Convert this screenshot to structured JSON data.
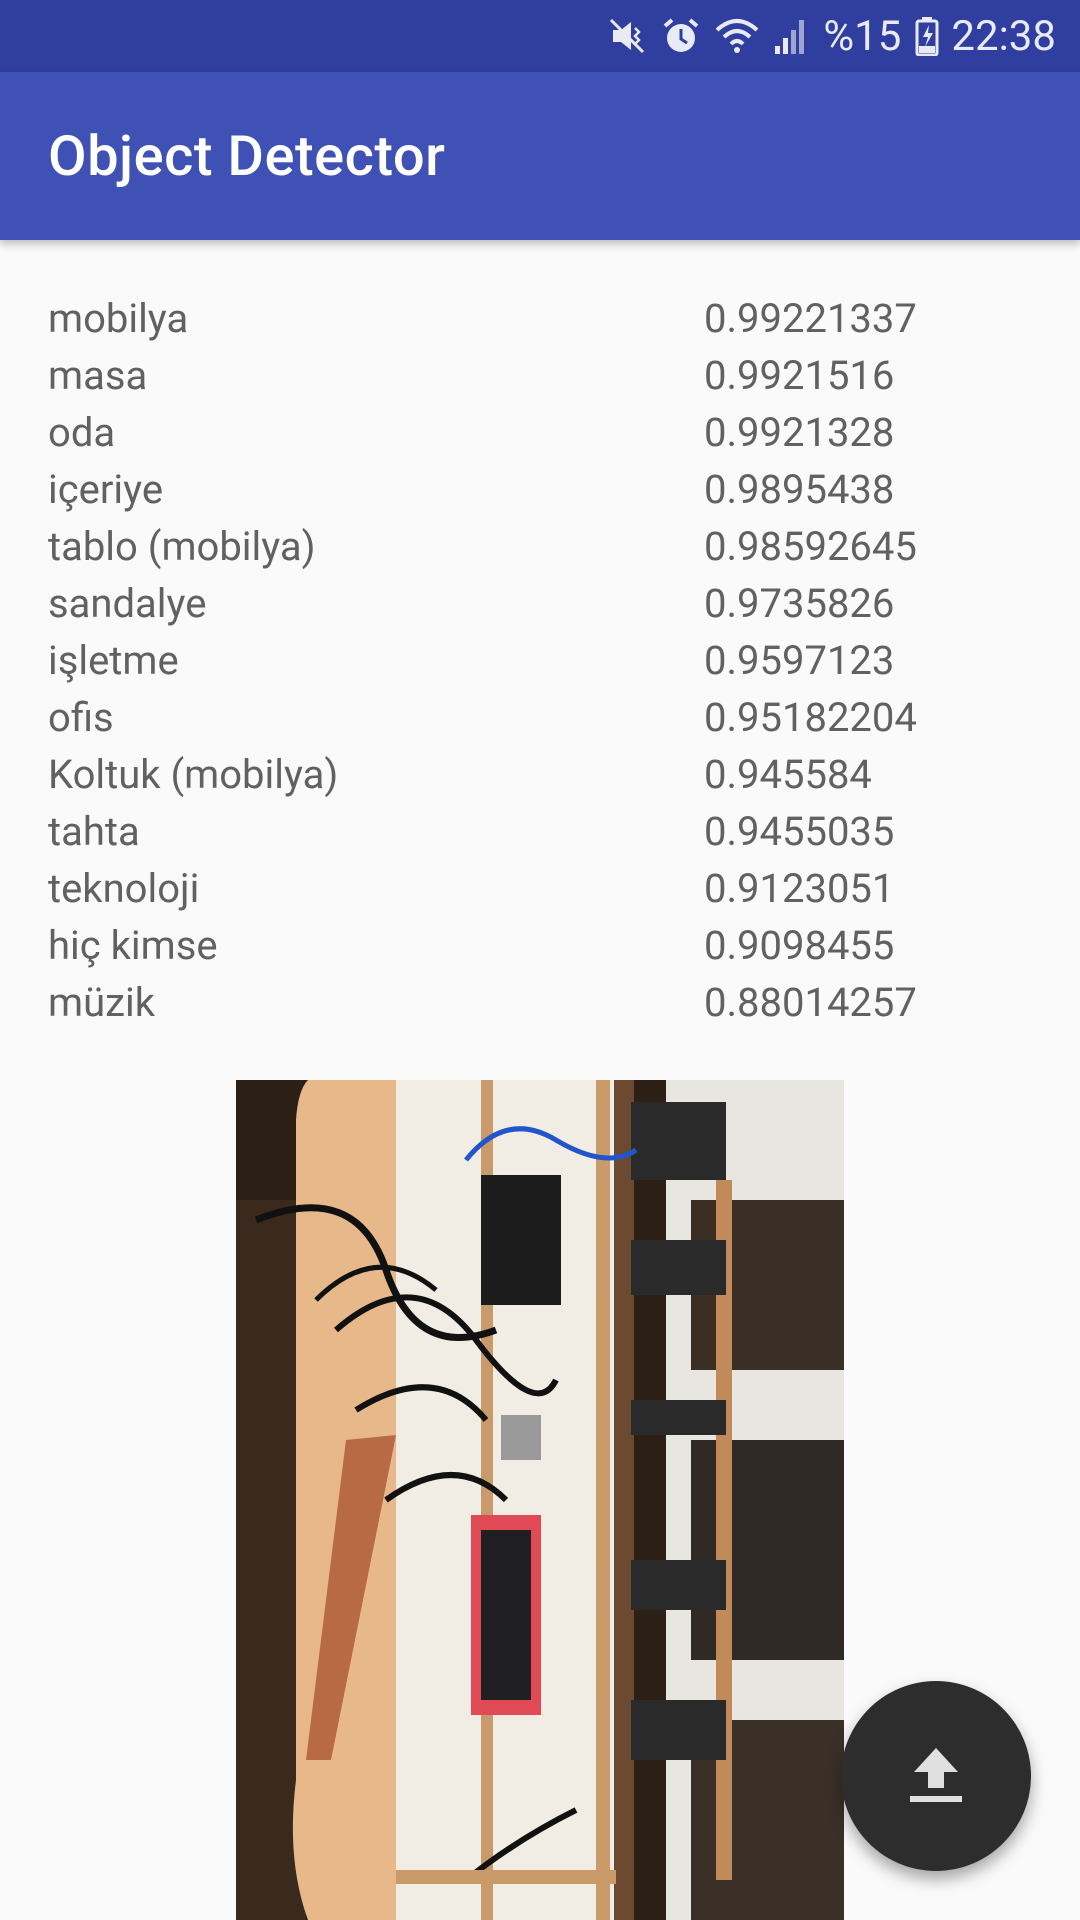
{
  "status_bar": {
    "battery_percent": "%15",
    "time": "22:38",
    "icons": [
      "mute-vibrate-icon",
      "alarm-icon",
      "wifi-icon",
      "signal-icon",
      "battery-charging-icon"
    ]
  },
  "app_bar": {
    "title": "Object Detector"
  },
  "results": [
    {
      "label": "mobilya",
      "score": "0.99221337"
    },
    {
      "label": "masa",
      "score": "0.9921516"
    },
    {
      "label": "oda",
      "score": "0.9921328"
    },
    {
      "label": "içeriye",
      "score": "0.9895438"
    },
    {
      "label": "tablo (mobilya)",
      "score": "0.98592645"
    },
    {
      "label": "sandalye",
      "score": "0.9735826"
    },
    {
      "label": "işletme",
      "score": "0.9597123"
    },
    {
      "label": "ofis",
      "score": "0.95182204"
    },
    {
      "label": "Koltuk (mobilya)",
      "score": "0.945584"
    },
    {
      "label": "tahta",
      "score": "0.9455035"
    },
    {
      "label": "teknoloji",
      "score": "0.9123051"
    },
    {
      "label": "hiç kimse",
      "score": "0.9098455"
    },
    {
      "label": "müzik",
      "score": "0.88014257"
    }
  ],
  "fab": {
    "icon": "upload-icon"
  },
  "colors": {
    "status_bar": "#303f9f",
    "app_bar": "#3f51b5",
    "background": "#fafafa",
    "text": "#616161",
    "fab": "#2d2d2d"
  }
}
